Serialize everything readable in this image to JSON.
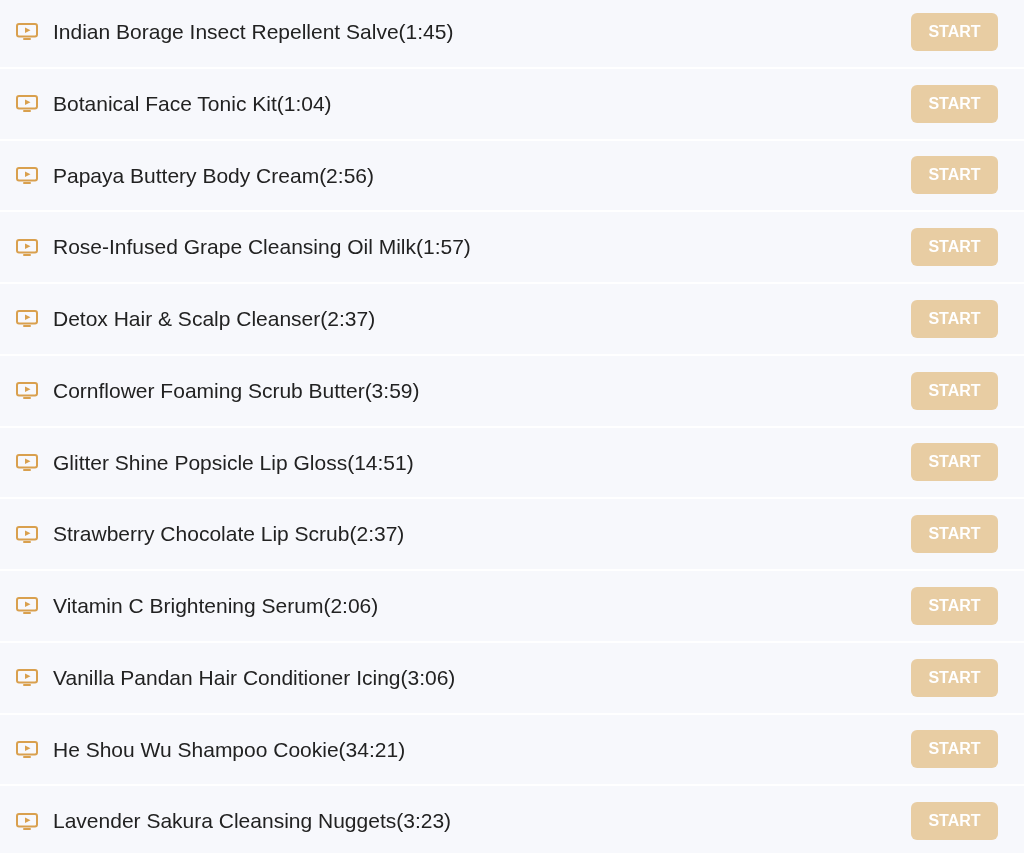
{
  "lessons": [
    {
      "title": "Indian Borage Insect Repellent Salve(1:45)",
      "button": "START"
    },
    {
      "title": "Botanical Face Tonic Kit(1:04)",
      "button": "START"
    },
    {
      "title": "Papaya Buttery Body Cream(2:56)",
      "button": "START"
    },
    {
      "title": "Rose-Infused Grape Cleansing Oil Milk(1:57)",
      "button": "START"
    },
    {
      "title": "Detox Hair & Scalp Cleanser(2:37)",
      "button": "START"
    },
    {
      "title": "Cornflower Foaming Scrub Butter(3:59)",
      "button": "START"
    },
    {
      "title": "Glitter Shine Popsicle Lip Gloss(14:51)",
      "button": "START"
    },
    {
      "title": "Strawberry Chocolate Lip Scrub(2:37)",
      "button": "START"
    },
    {
      "title": "Vitamin C Brightening Serum(2:06)",
      "button": "START"
    },
    {
      "title": "Vanilla Pandan Hair Conditioner Icing(3:06)",
      "button": "START"
    },
    {
      "title": "He Shou Wu Shampoo Cookie(34:21)",
      "button": "START"
    },
    {
      "title": "Lavender Sakura Cleansing Nuggets(3:23)",
      "button": "START"
    }
  ]
}
